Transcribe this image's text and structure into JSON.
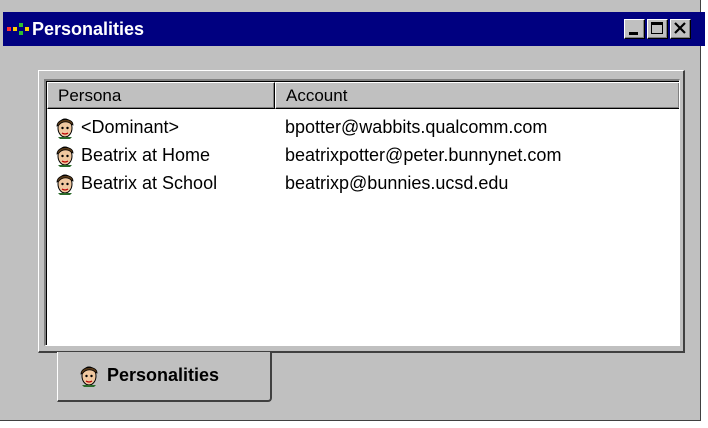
{
  "window": {
    "title": "Personalities",
    "icon": "app-icon",
    "controls": [
      "minimize-icon",
      "maximize-icon",
      "close-icon"
    ]
  },
  "list": {
    "columns": {
      "persona": "Persona",
      "account": "Account"
    },
    "rows": [
      {
        "persona": "<Dominant>",
        "account": "bpotter@wabbits.qualcomm.com",
        "icon": "persona-face-icon"
      },
      {
        "persona": "Beatrix at Home",
        "account": "beatrixpotter@peter.bunnynet.com",
        "icon": "persona-face-icon"
      },
      {
        "persona": "Beatrix at School",
        "account": "beatrixp@bunnies.ucsd.edu",
        "icon": "persona-face-icon"
      }
    ]
  },
  "tabs": [
    {
      "label": "Personalities",
      "icon": "persona-face-icon",
      "active": true
    }
  ],
  "colors": {
    "titlebar": "#000080",
    "face": "#c0c0c0"
  }
}
